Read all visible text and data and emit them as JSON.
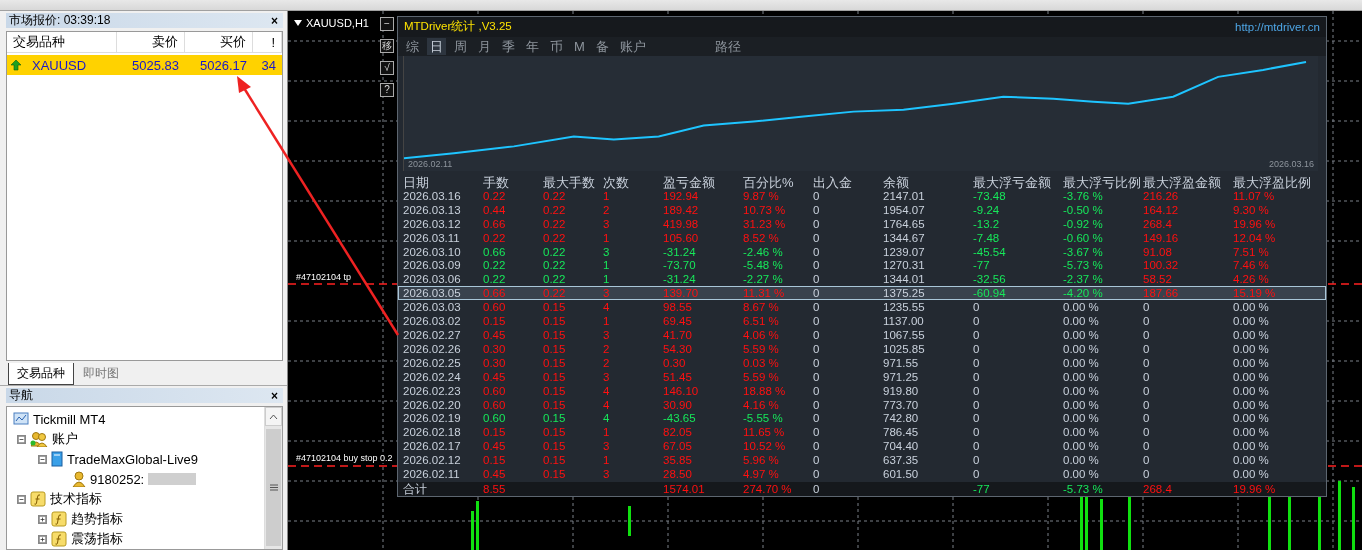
{
  "market_watch": {
    "title": "市场报价: 03:39:18",
    "close_label": "×",
    "columns": [
      "交易品种",
      "卖价",
      "买价",
      "!"
    ],
    "rows": [
      {
        "symbol": "XAUUSD",
        "bid": "5025.83",
        "ask": "5026.17",
        "spread": "34",
        "selected": true
      }
    ],
    "tabs": [
      {
        "label": "交易品种",
        "selected": true
      },
      {
        "label": "即时图",
        "selected": false
      }
    ]
  },
  "navigator": {
    "title": "导航",
    "close_label": "×",
    "tree": [
      {
        "label": "Tickmill MT4",
        "kind": "terminal",
        "children": [
          {
            "label": "账户",
            "kind": "accounts",
            "expanded": true,
            "children": [
              {
                "label": "TradeMaxGlobal-Live9",
                "kind": "server",
                "expanded": true,
                "children": [
                  {
                    "label": "9180252:",
                    "kind": "user",
                    "redacted": true
                  }
                ]
              }
            ]
          },
          {
            "label": "技术指标",
            "kind": "indicators",
            "expanded": true,
            "children": [
              {
                "label": "趋势指标",
                "kind": "indicators",
                "expanded": false
              },
              {
                "label": "震荡指标",
                "kind": "indicators",
                "expanded": false
              }
            ]
          }
        ]
      }
    ]
  },
  "chart": {
    "title": "XAUUSD,H1",
    "side_buttons": [
      "−",
      "移",
      "√",
      "?"
    ],
    "order_lines": [
      {
        "label": "#47102104 tp"
      },
      {
        "label": "#47102104 buy stop 0.2"
      }
    ]
  },
  "stats": {
    "title": "MTDriver统计 ,V3.25",
    "link": "http://mtdriver.cn",
    "tabs": [
      {
        "label": "综",
        "selected": false
      },
      {
        "label": "日",
        "selected": true
      },
      {
        "label": "周",
        "selected": false
      },
      {
        "label": "月",
        "selected": false
      },
      {
        "label": "季",
        "selected": false
      },
      {
        "label": "年",
        "selected": false
      },
      {
        "label": "币",
        "selected": false
      },
      {
        "label": "M",
        "selected": false
      },
      {
        "label": "备",
        "selected": false
      },
      {
        "label": "账户",
        "selected": false
      }
    ],
    "path_tab": {
      "label": "路径",
      "selected": false
    },
    "equity_chart": {
      "start_label": "2026.02.11",
      "end_label": "2026.03.16"
    },
    "columns": [
      "日期",
      "手数",
      "最大手数",
      "次数",
      "盈亏金额",
      "百分比%",
      "出入金",
      "余额",
      "最大浮亏金额",
      "最大浮亏比例",
      "最大浮盈金额",
      "最大浮盈比例"
    ],
    "rows": [
      {
        "cells": [
          "2026.03.16",
          "0.22",
          "0.22",
          "1",
          "192.94",
          "9.87 %",
          "0",
          "2147.01",
          "-73.48",
          "-3.76 %",
          "216.26",
          "11.07 %"
        ],
        "color": "#ff1010",
        "floating": true,
        "selected": false
      },
      {
        "cells": [
          "2026.03.13",
          "0.44",
          "0.22",
          "2",
          "189.42",
          "10.73 %",
          "0",
          "1954.07",
          "-9.24",
          "-0.50 %",
          "164.12",
          "9.30 %"
        ],
        "color": "#ff1010",
        "floating": true,
        "selected": false
      },
      {
        "cells": [
          "2026.03.12",
          "0.66",
          "0.22",
          "3",
          "419.98",
          "31.23 %",
          "0",
          "1764.65",
          "-13.2",
          "-0.92 %",
          "268.4",
          "19.96 %"
        ],
        "color": "#ff1010",
        "floating": true,
        "selected": false
      },
      {
        "cells": [
          "2026.03.11",
          "0.22",
          "0.22",
          "1",
          "105.60",
          "8.52 %",
          "0",
          "1344.67",
          "-7.48",
          "-0.60 %",
          "149.16",
          "12.04 %"
        ],
        "color": "#ff1010",
        "floating": true,
        "selected": false
      },
      {
        "cells": [
          "2026.03.10",
          "0.66",
          "0.22",
          "3",
          "-31.24",
          "-2.46 %",
          "0",
          "1239.07",
          "-45.54",
          "-3.67 %",
          "91.08",
          "7.51 %"
        ],
        "color": "#16e85a",
        "floating": true,
        "selected": false
      },
      {
        "cells": [
          "2026.03.09",
          "0.22",
          "0.22",
          "1",
          "-73.70",
          "-5.48 %",
          "0",
          "1270.31",
          "-77",
          "-5.73 %",
          "100.32",
          "7.46 %"
        ],
        "color": "#16e85a",
        "floating": true,
        "selected": false
      },
      {
        "cells": [
          "2026.03.06",
          "0.22",
          "0.22",
          "1",
          "-31.24",
          "-2.27 %",
          "0",
          "1344.01",
          "-32.56",
          "-2.37 %",
          "58.52",
          "4.26 %"
        ],
        "color": "#16e85a",
        "floating": true,
        "selected": false
      },
      {
        "cells": [
          "2026.03.05",
          "0.66",
          "0.22",
          "3",
          "139.70",
          "11.31 %",
          "0",
          "1375.25",
          "-60.94",
          "-4.20 %",
          "187.66",
          "15.19 %"
        ],
        "color": "#ff1010",
        "floating": true,
        "selected": true
      },
      {
        "cells": [
          "2026.03.03",
          "0.60",
          "0.15",
          "4",
          "98.55",
          "8.67 %",
          "0",
          "1235.55",
          "0",
          "0.00 %",
          "0",
          "0.00 %"
        ],
        "color": "#ff1010",
        "floating": false,
        "selected": false
      },
      {
        "cells": [
          "2026.03.02",
          "0.15",
          "0.15",
          "1",
          "69.45",
          "6.51 %",
          "0",
          "1137.00",
          "0",
          "0.00 %",
          "0",
          "0.00 %"
        ],
        "color": "#ff1010",
        "floating": false,
        "selected": false
      },
      {
        "cells": [
          "2026.02.27",
          "0.45",
          "0.15",
          "3",
          "41.70",
          "4.06 %",
          "0",
          "1067.55",
          "0",
          "0.00 %",
          "0",
          "0.00 %"
        ],
        "color": "#ff1010",
        "floating": false,
        "selected": false
      },
      {
        "cells": [
          "2026.02.26",
          "0.30",
          "0.15",
          "2",
          "54.30",
          "5.59 %",
          "0",
          "1025.85",
          "0",
          "0.00 %",
          "0",
          "0.00 %"
        ],
        "color": "#ff1010",
        "floating": false,
        "selected": false
      },
      {
        "cells": [
          "2026.02.25",
          "0.30",
          "0.15",
          "2",
          "0.30",
          "0.03 %",
          "0",
          "971.55",
          "0",
          "0.00 %",
          "0",
          "0.00 %"
        ],
        "color": "#ff1010",
        "floating": false,
        "selected": false
      },
      {
        "cells": [
          "2026.02.24",
          "0.45",
          "0.15",
          "3",
          "51.45",
          "5.59 %",
          "0",
          "971.25",
          "0",
          "0.00 %",
          "0",
          "0.00 %"
        ],
        "color": "#ff1010",
        "floating": false,
        "selected": false
      },
      {
        "cells": [
          "2026.02.23",
          "0.60",
          "0.15",
          "4",
          "146.10",
          "18.88 %",
          "0",
          "919.80",
          "0",
          "0.00 %",
          "0",
          "0.00 %"
        ],
        "color": "#ff1010",
        "floating": false,
        "selected": false
      },
      {
        "cells": [
          "2026.02.20",
          "0.60",
          "0.15",
          "4",
          "30.90",
          "4.16 %",
          "0",
          "773.70",
          "0",
          "0.00 %",
          "0",
          "0.00 %"
        ],
        "color": "#ff1010",
        "floating": false,
        "selected": false
      },
      {
        "cells": [
          "2026.02.19",
          "0.60",
          "0.15",
          "4",
          "-43.65",
          "-5.55 %",
          "0",
          "742.80",
          "0",
          "0.00 %",
          "0",
          "0.00 %"
        ],
        "color": "#16e85a",
        "floating": false,
        "selected": false
      },
      {
        "cells": [
          "2026.02.18",
          "0.15",
          "0.15",
          "1",
          "82.05",
          "11.65 %",
          "0",
          "786.45",
          "0",
          "0.00 %",
          "0",
          "0.00 %"
        ],
        "color": "#ff1010",
        "floating": false,
        "selected": false
      },
      {
        "cells": [
          "2026.02.17",
          "0.45",
          "0.15",
          "3",
          "67.05",
          "10.52 %",
          "0",
          "704.40",
          "0",
          "0.00 %",
          "0",
          "0.00 %"
        ],
        "color": "#ff1010",
        "floating": false,
        "selected": false
      },
      {
        "cells": [
          "2026.02.12",
          "0.15",
          "0.15",
          "1",
          "35.85",
          "5.96 %",
          "0",
          "637.35",
          "0",
          "0.00 %",
          "0",
          "0.00 %"
        ],
        "color": "#ff1010",
        "floating": false,
        "selected": false
      },
      {
        "cells": [
          "2026.02.11",
          "0.45",
          "0.15",
          "3",
          "28.50",
          "4.97 %",
          "0",
          "601.50",
          "0",
          "0.00 %",
          "0",
          "0.00 %"
        ],
        "color": "#ff1010",
        "floating": false,
        "selected": false
      }
    ],
    "total": {
      "cells": [
        "合计",
        "8.55",
        "",
        "",
        "1574.01",
        "274.70 %",
        "0",
        "",
        "-77",
        "-5.73 %",
        "268.4",
        "19.96 %"
      ],
      "color": "#ff1010",
      "floating": true
    }
  }
}
